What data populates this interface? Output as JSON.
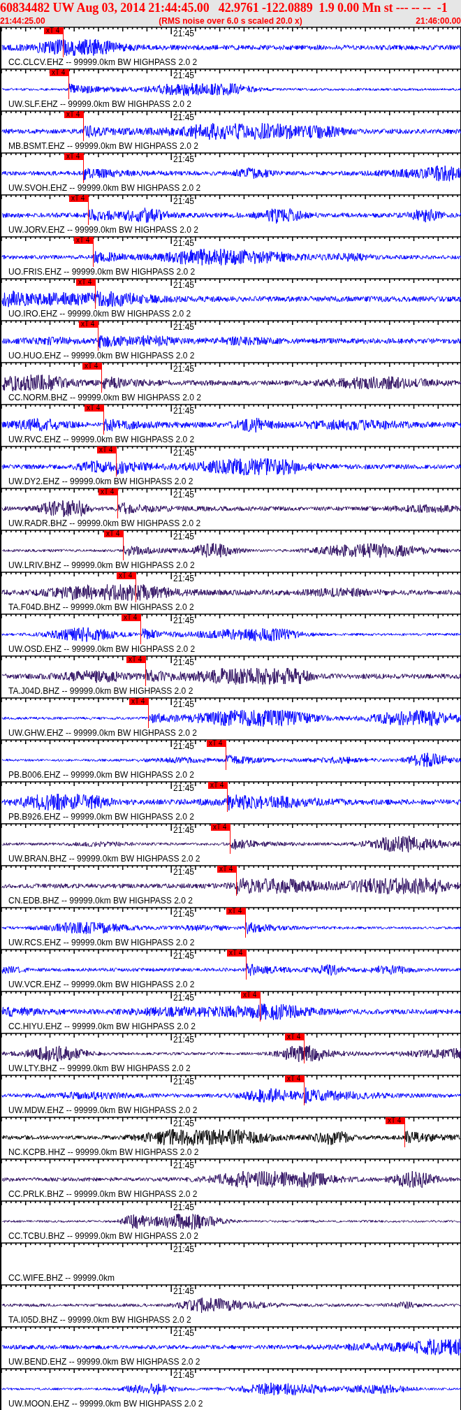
{
  "header": {
    "title": "60834482 UW Aug 03, 2014 21:44:45.00   42.9761 -122.0889  1.9 0.00 Mn st --- -- --  -1",
    "start_time": "21:44:25.00",
    "note": "(RMS noise over 6.0 s scaled 20.0 x)",
    "end_time": "21:46:00.00"
  },
  "traces": [
    {
      "label": "CC.CLCV.EHZ -- 99999.0km BW HIGHPASS 2.0 2",
      "kind": "waveform",
      "color": "#0000ff",
      "time_label": "21:45",
      "pick": {
        "label": "xT 4"
      }
    },
    {
      "label": "UW.SLF.EHZ -- 99999.0km BW HIGHPASS 2.0 2",
      "kind": "waveform",
      "color": "#0000ff",
      "time_label": "21:45",
      "pick": {
        "label": "xT 4"
      }
    },
    {
      "label": "MB.BSMT.EHZ -- 99999.0km BW HIGHPASS 2.0 2",
      "kind": "waveform",
      "color": "#0000ff",
      "time_label": "21:45",
      "pick": {
        "label": "xT 4"
      }
    },
    {
      "label": "UW.SVOH.EHZ -- 99999.0km BW HIGHPASS 2.0 2",
      "kind": "waveform",
      "color": "#0000ff",
      "time_label": "21:45",
      "pick": {
        "label": "xT 4"
      }
    },
    {
      "label": "UW.JORV.EHZ -- 99999.0km BW HIGHPASS 2.0 2",
      "kind": "waveform",
      "color": "#0000ff",
      "time_label": "21:45",
      "pick": {
        "label": "xT 4"
      }
    },
    {
      "label": "UO.FRIS.EHZ -- 99999.0km BW HIGHPASS 2.0 2",
      "kind": "waveform",
      "color": "#0000ff",
      "time_label": "21:45",
      "pick": {
        "label": "xT 4"
      }
    },
    {
      "label": "UO.IRO.EHZ -- 99999.0km BW HIGHPASS 2.0 2",
      "kind": "waveform",
      "color": "#0000ff",
      "time_label": "21:45",
      "pick": {
        "label": "xT 4"
      }
    },
    {
      "label": "UO.HUO.EHZ -- 99999.0km BW HIGHPASS 2.0 2",
      "kind": "waveform",
      "color": "#0000ff",
      "time_label": "21:45",
      "pick": {
        "label": "xT 4"
      }
    },
    {
      "label": "CC.NORM.BHZ -- 99999.0km BW HIGHPASS 2.0 2",
      "kind": "waveform",
      "color": "#2a0a5e",
      "time_label": "21:45",
      "pick": {
        "label": "xT 4"
      }
    },
    {
      "label": "UW.RVC.EHZ -- 99999.0km BW HIGHPASS 2.0 2",
      "kind": "waveform",
      "color": "#0000ff",
      "time_label": "21:45",
      "pick": {
        "label": "xT 4"
      }
    },
    {
      "label": "UW.DY2.EHZ -- 99999.0km BW HIGHPASS 2.0 2",
      "kind": "waveform",
      "color": "#0000ff",
      "time_label": "21:45",
      "pick": {
        "label": "xT 4"
      }
    },
    {
      "label": "UW.RADR.BHZ -- 99999.0km BW HIGHPASS 2.0 2",
      "kind": "waveform",
      "color": "#2a0a5e",
      "time_label": "21:45",
      "pick": {
        "label": "xT 4"
      }
    },
    {
      "label": "UW.LRIV.BHZ -- 99999.0km BW HIGHPASS 2.0 2",
      "kind": "waveform",
      "color": "#2a0a5e",
      "time_label": "21:45",
      "pick": {
        "label": "xT 4"
      }
    },
    {
      "label": "TA.F04D.BHZ -- 99999.0km BW HIGHPASS 2.0 2",
      "kind": "waveform",
      "color": "#2a0a5e",
      "time_label": "21:45",
      "pick": {
        "label": "xT 4"
      }
    },
    {
      "label": "UW.OSD.EHZ -- 99999.0km BW HIGHPASS 2.0 2",
      "kind": "waveform",
      "color": "#0000ff",
      "time_label": "21:45",
      "pick": {
        "label": "xT 4"
      }
    },
    {
      "label": "TA.J04D.BHZ -- 99999.0km BW HIGHPASS 2.0 2",
      "kind": "waveform",
      "color": "#2a0a5e",
      "time_label": "21:45",
      "pick": {
        "label": "xT 4"
      }
    },
    {
      "label": "UW.GHW.EHZ -- 99999.0km BW HIGHPASS 2.0 2",
      "kind": "waveform",
      "color": "#0000ff",
      "time_label": "21:45",
      "pick": {
        "label": "xT 4"
      }
    },
    {
      "label": "PB.B006.EHZ -- 99999.0km BW HIGHPASS 2.0 2",
      "kind": "waveform",
      "color": "#0000ff",
      "time_label": "21:45",
      "pick": {
        "label": "xT 4"
      }
    },
    {
      "label": "PB.B926.EHZ -- 99999.0km BW HIGHPASS 2.0 2",
      "kind": "waveform",
      "color": "#0000ff",
      "time_label": "21:45",
      "pick": {
        "label": "xT 4"
      }
    },
    {
      "label": "UW.BRAN.BHZ -- 99999.0km BW HIGHPASS 2.0 2",
      "kind": "waveform",
      "color": "#2a0a5e",
      "time_label": "21:45",
      "pick": {
        "label": "xT 4"
      }
    },
    {
      "label": "CN.EDB.BHZ -- 99999.0km BW HIGHPASS 2.0 2",
      "kind": "waveform",
      "color": "#2a0a5e",
      "time_label": "21:45",
      "pick": {
        "label": "xT 4"
      }
    },
    {
      "label": "UW.RCS.EHZ -- 99999.0km BW HIGHPASS 2.0 2",
      "kind": "waveform",
      "color": "#0000ff",
      "time_label": "21:45",
      "pick": {
        "label": "xT 4"
      }
    },
    {
      "label": "UW.VCR.EHZ -- 99999.0km BW HIGHPASS 2.0 2",
      "kind": "waveform",
      "color": "#0000ff",
      "time_label": "21:45",
      "pick": {
        "label": "xT 4"
      }
    },
    {
      "label": "CC.HIYU.EHZ -- 99999.0km BW HIGHPASS 2.0 2",
      "kind": "waveform",
      "color": "#0000ff",
      "time_label": "21:45",
      "pick": {
        "label": "xT 4"
      }
    },
    {
      "label": "UW.LTY.BHZ -- 99999.0km BW HIGHPASS 2.0 2",
      "kind": "waveform",
      "color": "#2a0a5e",
      "time_label": "21:45",
      "pick": {
        "label": "xT 4"
      }
    },
    {
      "label": "UW.MDW.EHZ -- 99999.0km BW HIGHPASS 2.0 2",
      "kind": "waveform",
      "color": "#0000ff",
      "time_label": "21:45",
      "pick": {
        "label": "xT 4"
      }
    },
    {
      "label": "NC.KCPB.HHZ -- 99999.0km BW HIGHPASS 2.0 2",
      "kind": "waveform",
      "color": "#000000",
      "time_label": "21:45",
      "pick": {
        "label": "xT 4"
      }
    },
    {
      "label": "CC.PRLK.BHZ -- 99999.0km BW HIGHPASS 2.0 2",
      "kind": "waveform",
      "color": "#2a0a5e",
      "time_label": "21:45"
    },
    {
      "label": "CC.TCBU.BHZ -- 99999.0km BW HIGHPASS 2.0 2",
      "kind": "waveform",
      "color": "#2a0a5e",
      "time_label": "21:45"
    },
    {
      "label": "CC.WIFE.BHZ -- 99999.0km",
      "kind": "no-data",
      "time_label": "21:45"
    },
    {
      "label": "TA.I05D.BHZ -- 99999.0km BW HIGHPASS 2.0 2",
      "kind": "waveform",
      "color": "#2a0a5e",
      "time_label": "21:45"
    },
    {
      "label": "UW.BEND.EHZ -- 99999.0km BW HIGHPASS 2.0 2",
      "kind": "waveform",
      "color": "#0000ff",
      "time_label": "21:45"
    },
    {
      "label": "UW.MOON.EHZ -- 99999.0km BW HIGHPASS 2.0 2",
      "kind": "waveform",
      "color": "#0000ff",
      "time_label": "21:45"
    }
  ]
}
